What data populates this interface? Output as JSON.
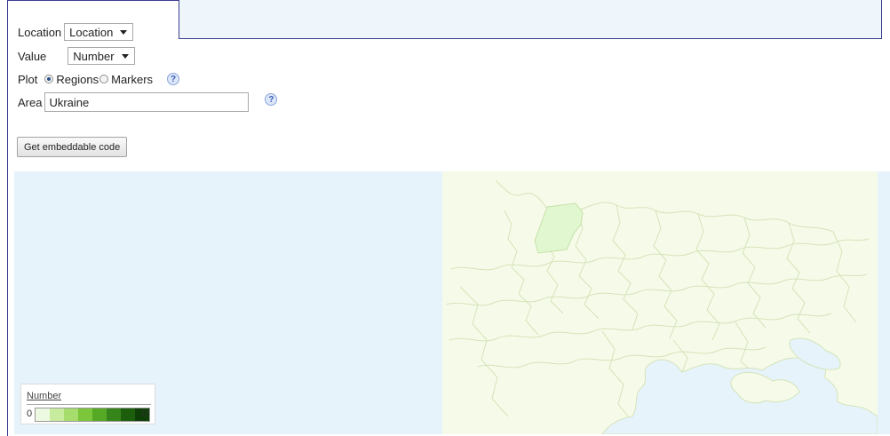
{
  "controls": {
    "location": {
      "label": "Location",
      "value": "Location"
    },
    "value": {
      "label": "Value",
      "value": "Number"
    },
    "plot": {
      "label": "Plot",
      "options": [
        "Regions",
        "Markers"
      ],
      "selected": "Regions"
    },
    "area": {
      "label": "Area",
      "value": "Ukraine"
    },
    "help_glyph": "?"
  },
  "embed_button": "Get embeddable code",
  "legend": {
    "title": "Number",
    "min": "0",
    "max": "0",
    "colors": [
      "#eef9e2",
      "#c8ec9e",
      "#a7dd6c",
      "#7cc63b",
      "#56a925",
      "#36851a",
      "#1d5e0c",
      "#0e3f06"
    ]
  },
  "map": {
    "ocean_color": "#e6f3fb",
    "land_color": "#f6fbe9",
    "border_color": "#d5e3b9",
    "highlight_color": "#e1f7cf",
    "sea_color": "#e6f3fb"
  }
}
